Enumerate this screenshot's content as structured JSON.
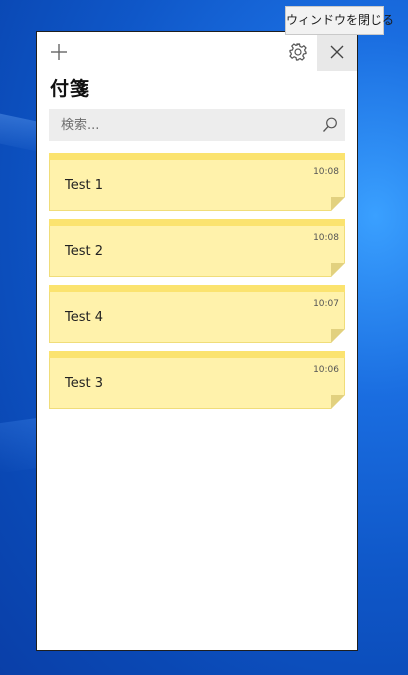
{
  "window": {
    "title": "付箋",
    "close_tooltip": "ウィンドウを閉じる"
  },
  "icons": {
    "add": "plus-icon",
    "settings": "gear-icon",
    "close": "close-icon",
    "search": "search-icon"
  },
  "search": {
    "placeholder": "検索..."
  },
  "notes": [
    {
      "text": "Test 1",
      "time": "10:08"
    },
    {
      "text": "Test 2",
      "time": "10:08"
    },
    {
      "text": "Test 4",
      "time": "10:07"
    },
    {
      "text": "Test 3",
      "time": "10:06"
    }
  ],
  "colors": {
    "note_body": "#fff2ab",
    "note_bar": "#fbe36f",
    "desktop": "#0f57c8"
  }
}
